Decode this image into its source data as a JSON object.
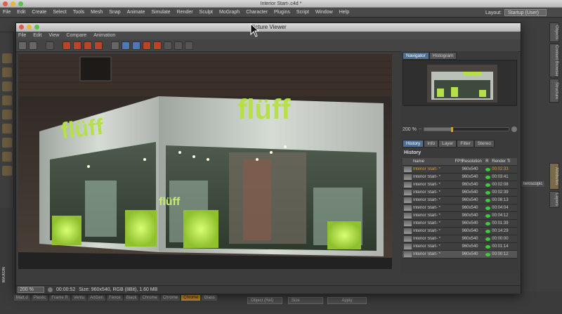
{
  "app": {
    "window_title": "Interior Start-.c4d *",
    "menu": [
      "File",
      "Edit",
      "Create",
      "Select",
      "Tools",
      "Mesh",
      "Snap",
      "Animate",
      "Simulate",
      "Render",
      "Sculpt",
      "MoGraph",
      "Character",
      "Plugins",
      "Script",
      "Window",
      "Help"
    ],
    "layout_label": "Layout:",
    "layout_value": "Startup (User)"
  },
  "right_tabs": [
    "Objects",
    "Content Browser",
    "Structure",
    "Attributes",
    "Layers"
  ],
  "materials": {
    "items": [
      "Matt.d",
      "Plastic",
      "Frame R",
      "Ventu",
      "ArtGen",
      "Fence",
      "Black",
      "Chrome",
      "Chrome",
      "Chrome",
      "Glass"
    ],
    "active_index": 9
  },
  "attributes": {
    "object_field": "Object (Rel)",
    "size_field": "Size",
    "apply_button": "Apply",
    "partial_tab": "teroscopic"
  },
  "viewer": {
    "title": "Picture Viewer",
    "menu": [
      "File",
      "Edit",
      "View",
      "Compare",
      "Animation"
    ],
    "navigator_tabs": [
      "Navigator",
      "Histogram"
    ],
    "zoom": "200 %",
    "zoom_fraction": 0.32,
    "panel_tabs": [
      "History",
      "Info",
      "Layer",
      "Filter",
      "Stereo"
    ],
    "history_label": "History",
    "columns": [
      "Name",
      "FPS",
      "Resolution",
      "R",
      "Render Ti"
    ],
    "history": [
      {
        "name": "Interior Start- *",
        "res": "960x540",
        "time": "00:02:33"
      },
      {
        "name": "Interior Start- *",
        "res": "960x540",
        "time": "00:03:41"
      },
      {
        "name": "Interior Start- *",
        "res": "960x540",
        "time": "00:02:08"
      },
      {
        "name": "Interior Start- *",
        "res": "960x540",
        "time": "00:02:39"
      },
      {
        "name": "Interior Start- *",
        "res": "960x540",
        "time": "00:08:13"
      },
      {
        "name": "Interior Start- *",
        "res": "960x540",
        "time": "00:04:04"
      },
      {
        "name": "Interior Start- *",
        "res": "960x540",
        "time": "00:04:12"
      },
      {
        "name": "Interior Start- *",
        "res": "960x540",
        "time": "00:01:39"
      },
      {
        "name": "Interior Start- *",
        "res": "960x540",
        "time": "00:14:29"
      },
      {
        "name": "Interior Start- *",
        "res": "960x540",
        "time": "00:00:00"
      },
      {
        "name": "Interior Start- *",
        "res": "960x540",
        "time": "00:01:14"
      },
      {
        "name": "Interior Start- *",
        "res": "960x540",
        "time": "00:00:12"
      }
    ],
    "status": {
      "zoom": "200 %",
      "time": "00:00:52",
      "info": "Size: 960x540, RGB (8Bit), 1.60 MB"
    }
  },
  "render": {
    "sign_large": "flüff",
    "sign_small": "flüff",
    "sign_side": "flüff",
    "accent_green": "#b5e04a",
    "wall": "#c9cfc8"
  },
  "brand_logo": "MAXON"
}
